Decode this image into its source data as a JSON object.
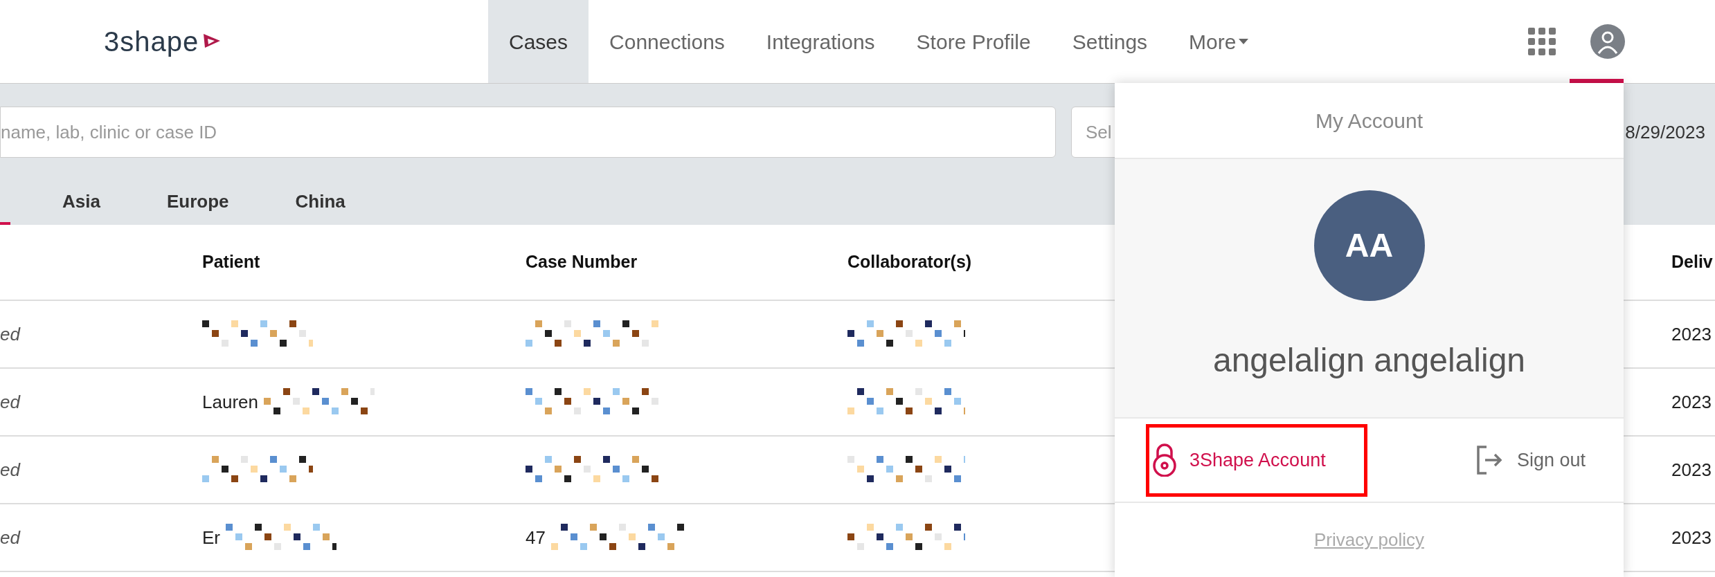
{
  "header": {
    "logo": "3shape",
    "nav": [
      {
        "label": "Cases",
        "selected": true
      },
      {
        "label": "Connections",
        "selected": false
      },
      {
        "label": "Integrations",
        "selected": false
      },
      {
        "label": "Store Profile",
        "selected": false
      },
      {
        "label": "Settings",
        "selected": false
      },
      {
        "label": "More",
        "selected": false,
        "kind": "menu"
      }
    ]
  },
  "filters": {
    "search_placeholder": "name, lab, clinic or case ID",
    "select_placeholder": "Sel",
    "date": "8/29/2023"
  },
  "region_tabs": [
    {
      "selected": true
    },
    {
      "label": "Asia",
      "selected": false
    },
    {
      "label": "Europe",
      "selected": false
    },
    {
      "label": "China",
      "selected": false
    }
  ],
  "table": {
    "columns": [
      "Patient",
      "Case Number",
      "Collaborator(s)",
      "Deliv"
    ],
    "rows": [
      {
        "status": "ed",
        "delivery": "2023"
      },
      {
        "status": "ed",
        "patient": "Lauren",
        "delivery": "2023"
      },
      {
        "status": "ed",
        "delivery": "2023"
      },
      {
        "status": "ed",
        "patient": "Er",
        "case_number": "47",
        "delivery": "2023"
      }
    ]
  },
  "account_menu": {
    "title": "My Account",
    "initials": "AA",
    "name": "angelalign angelalign",
    "account_link": "3Shape Account",
    "sign_out": "Sign out",
    "privacy": "Privacy policy"
  }
}
